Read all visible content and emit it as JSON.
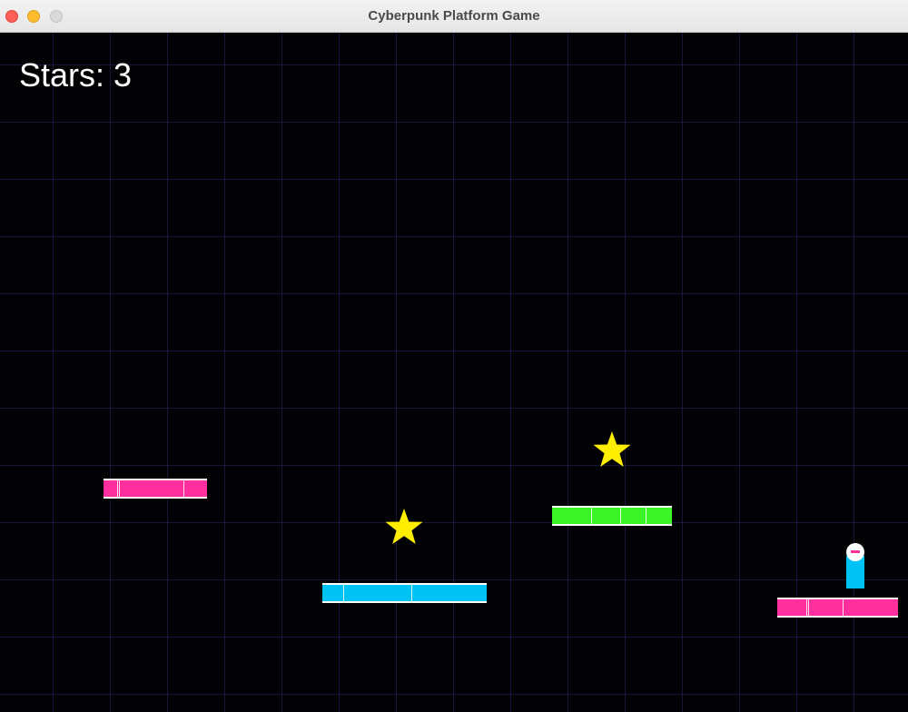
{
  "window": {
    "title": "Cyberpunk Platform Game"
  },
  "hud": {
    "stars_label": "Stars: 3"
  },
  "colors": {
    "background": "#000000",
    "grid": "#1c1c4a",
    "platform_pink": "#ff2f9e",
    "platform_cyan": "#00c3f5",
    "platform_green": "#3cf528",
    "star": "#ffee00",
    "player_body": "#00c3f5",
    "player_head": "#ffffff",
    "player_visor": "#ff2f9e"
  },
  "platforms": [
    {
      "color": "pink"
    },
    {
      "color": "cyan"
    },
    {
      "color": "green"
    },
    {
      "color": "pink"
    }
  ],
  "stars": [
    {
      "icon": "star-icon"
    },
    {
      "icon": "star-icon"
    }
  ],
  "player": {
    "icon": "player-character"
  }
}
